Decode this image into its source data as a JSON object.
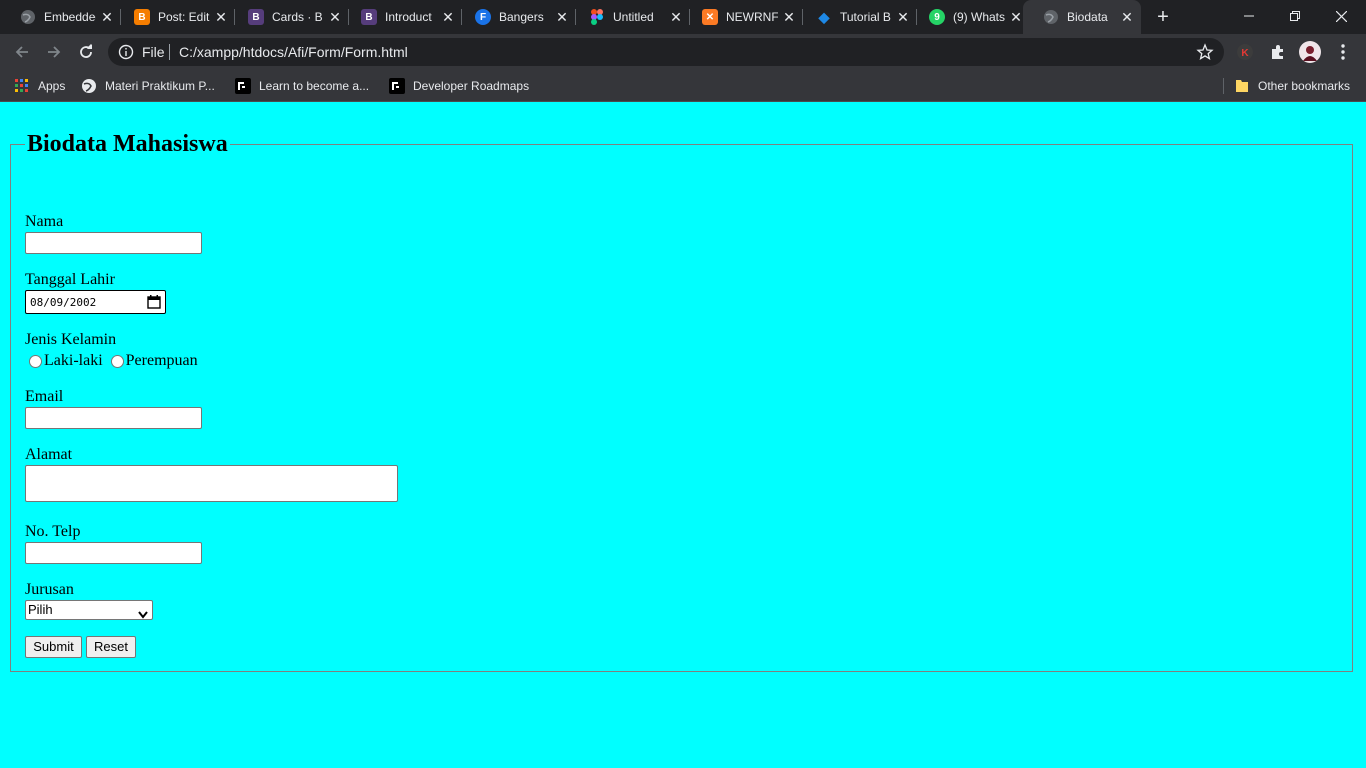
{
  "browser": {
    "tabs": [
      {
        "title": "Embedded",
        "icon": "globe-icon",
        "color": "#5f6368"
      },
      {
        "title": "Post: Edit",
        "icon": "blogger-icon",
        "color": "#f57d00"
      },
      {
        "title": "Cards · B",
        "icon": "bootstrap-icon",
        "color": "#563d7c"
      },
      {
        "title": "Introduct",
        "icon": "bootstrap-icon",
        "color": "#563d7c"
      },
      {
        "title": "Bangers",
        "icon": "google-fonts-icon",
        "color": "#1a73e8"
      },
      {
        "title": "Untitled",
        "icon": "figma-icon",
        "color": "#a259ff"
      },
      {
        "title": "NEWRNF",
        "icon": "xampp-icon",
        "color": "#fb7a24"
      },
      {
        "title": "Tutorial B",
        "icon": "codepolitan-icon",
        "color": "#1e88e5"
      },
      {
        "title": "(9) Whats",
        "icon": "whatsapp-icon",
        "color": "#25d366"
      },
      {
        "title": "Biodata",
        "icon": "globe-icon",
        "color": "#5f6368"
      }
    ],
    "active_tab": 9,
    "address": {
      "scheme_label": "File",
      "url": "C:/xampp/htdocs/Afi/Form/Form.html"
    },
    "profile_initial": "K",
    "bookmarks": [
      {
        "label": "Apps",
        "icon": "apps-grid-icon"
      },
      {
        "label": "Materi Praktikum P...",
        "icon": "globe-icon"
      },
      {
        "label": "Learn to become a...",
        "icon": "roadmap-icon"
      },
      {
        "label": "Developer Roadmaps",
        "icon": "roadmap-icon"
      }
    ],
    "other_bookmarks": "Other bookmarks"
  },
  "form": {
    "legend": "Biodata Mahasiswa",
    "nama_label": "Nama",
    "nama_value": "",
    "tgl_label": "Tanggal Lahir",
    "tgl_value": "08/09/2002",
    "jk_label": "Jenis Kelamin",
    "jk_options": [
      "Laki-laki",
      "Perempuan"
    ],
    "email_label": "Email",
    "email_value": "",
    "alamat_label": "Alamat",
    "alamat_value": "",
    "telp_label": "No. Telp",
    "telp_value": "",
    "jurusan_label": "Jurusan",
    "jurusan_selected": "Pilih",
    "submit_label": "Submit",
    "reset_label": "Reset"
  },
  "colors": {
    "page_background": "#00ffff",
    "titlebar": "#202124",
    "toolbar": "#35363a"
  }
}
